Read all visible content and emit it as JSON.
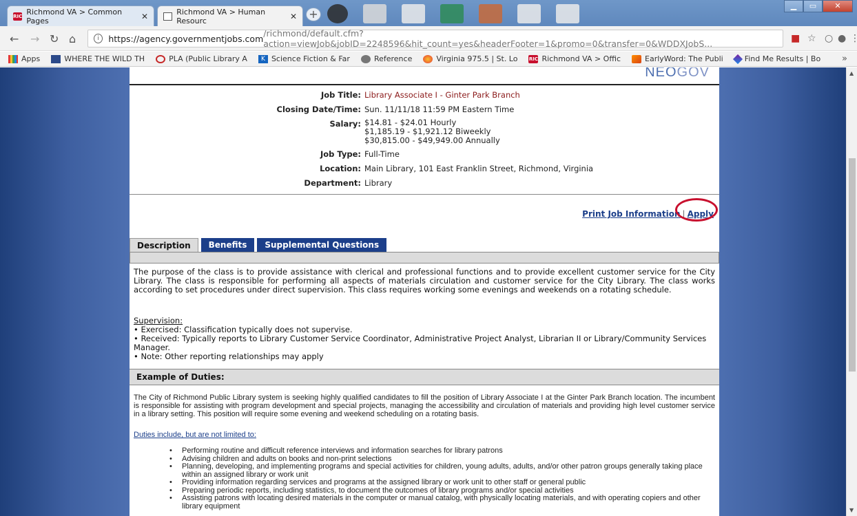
{
  "browser": {
    "tabs": [
      {
        "label": "Richmond VA > Common Pages",
        "icon": "ric-icon"
      },
      {
        "label": "Richmond VA > Human Resourc",
        "icon": "document-icon"
      }
    ],
    "url_host": "https://agency.governmentjobs.com",
    "url_path": "/richmond/default.cfm?action=viewJob&jobID=2248596&hit_count=yes&headerFooter=1&promo=0&transfer=0&WDDXJobS...",
    "bookmarks": [
      {
        "label": "Apps",
        "icon": "apps-icon"
      },
      {
        "label": "WHERE THE WILD TH",
        "icon": "bookmark-icon"
      },
      {
        "label": "PLA (Public Library A",
        "icon": "pla-icon"
      },
      {
        "label": "Science Fiction & Far",
        "icon": "k-icon"
      },
      {
        "label": "Reference",
        "icon": "reference-icon"
      },
      {
        "label": "Virginia 975.5 | St. Lo",
        "icon": "virginia-icon"
      },
      {
        "label": "Richmond VA > Offic",
        "icon": "ric-icon"
      },
      {
        "label": "EarlyWord: The Publi",
        "icon": "earlyword-icon"
      },
      {
        "label": "Find Me Results | Bo",
        "icon": "findme-icon"
      }
    ]
  },
  "brand": {
    "logo_a": "NEO",
    "logo_b": "GOV"
  },
  "job": {
    "title_label": "Job Title:",
    "title": "Library Associate I - Ginter Park Branch",
    "closing_label": "Closing Date/Time:",
    "closing": "Sun. 11/11/18 11:59 PM Eastern Time",
    "salary_label": "Salary:",
    "salary": [
      "$14.81 - $24.01 Hourly",
      "$1,185.19 - $1,921.12 Biweekly",
      "$30,815.00 - $49,949.00 Annually"
    ],
    "type_label": "Job Type:",
    "type": "Full-Time",
    "location_label": "Location:",
    "location": "Main Library, 101 East Franklin Street, Richmond, Virginia",
    "dept_label": "Department:",
    "dept": "Library"
  },
  "actions": {
    "print": "Print Job Information",
    "sep": "|",
    "apply": "Apply"
  },
  "tabs": [
    "Description",
    "Benefits",
    "Supplemental Questions"
  ],
  "description": {
    "purpose": "The purpose of the class is to provide assistance with clerical and professional functions and to provide excellent customer service for the City Library. The class is responsible for performing all aspects of materials circulation and customer service for the City Library. The class works according to set procedures under direct supervision. This class requires working some evenings and weekends on a rotating schedule.",
    "supervision_head": "Supervision:",
    "supervision": [
      "• Exercised: Classification typically does not supervise.",
      "• Received: Typically reports to Library Customer Service Coordinator, Administrative Project Analyst, Librarian II or Library/Community Services Manager.",
      "• Note: Other reporting relationships may apply"
    ]
  },
  "duties": {
    "heading": "Example of Duties:",
    "intro": "The City of Richmond Public Library system is seeking highly qualified candidates to fill the position of Library Associate I at the Ginter Park Branch location.  The incumbent is responsible for assisting with program development and special projects, managing the accessibility and circulation of materials and providing high level customer service in a library setting.  This position will require some evening and weekend scheduling on a rotating basis.",
    "list_head": "Duties include, but are not limited to:",
    "items": [
      "Performing routine and difficult reference interviews and information searches for library patrons",
      "Advising children and adults on books and non-print selections",
      "Planning, developing, and implementing programs and special activities for children, young adults, adults, and/or other patron groups generally taking place within an assigned library or work unit",
      "Providing information regarding services and programs at the assigned library or work unit to other staff or general public",
      "Preparing periodic reports, including statistics, to document the outcomes of library programs and/or special activities",
      "Assisting patrons with locating desired materials in the computer or manual catalog, with physically locating materials, and with operating copiers and other library equipment"
    ]
  }
}
